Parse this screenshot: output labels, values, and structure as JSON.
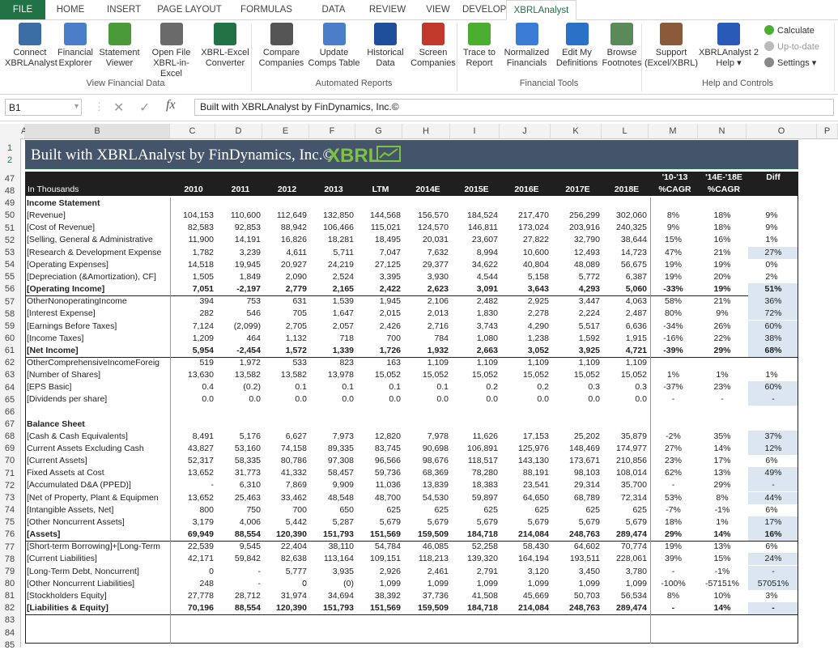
{
  "tabs": [
    "FILE",
    "HOME",
    "INSERT",
    "PAGE LAYOUT",
    "FORMULAS",
    "DATA",
    "REVIEW",
    "VIEW",
    "DEVELOPER",
    "XBRLAnalyst"
  ],
  "ribbon": {
    "buttons": [
      {
        "label": "Connect\nXBRLAnalyst",
        "icon": "connect-icon",
        "color": "#3a6ea5"
      },
      {
        "label": "Financial\nExplorer",
        "icon": "financial-explorer-icon",
        "color": "#4a7ec8"
      },
      {
        "label": "Statement\nViewer",
        "icon": "statement-viewer-icon",
        "color": "#4a9a3a"
      },
      {
        "label": "Open File\nXBRL-in-Excel",
        "icon": "open-file-icon",
        "color": "#6a6a6a"
      },
      {
        "label": "XBRL-Excel\nConverter",
        "icon": "converter-icon",
        "color": "#217346"
      },
      {
        "label": "Compare\nCompanies",
        "icon": "compare-companies-icon",
        "color": "#555"
      },
      {
        "label": "Update\nComps Table",
        "icon": "update-comps-icon",
        "color": "#4a7ec8"
      },
      {
        "label": "Historical\nData",
        "icon": "historical-data-icon",
        "color": "#1f4e9a"
      },
      {
        "label": "Screen\nCompanies",
        "icon": "screen-companies-icon",
        "color": "#c0392b"
      },
      {
        "label": "Trace to\nReport",
        "icon": "trace-report-icon",
        "color": "#4cae30"
      },
      {
        "label": "Normalized\nFinancials",
        "icon": "normalized-financials-icon",
        "color": "#3a7bd5"
      },
      {
        "label": "Edit My\nDefinitions",
        "icon": "edit-definitions-icon",
        "color": "#2a72c8"
      },
      {
        "label": "Browse\nFootnotes",
        "icon": "browse-footnotes-icon",
        "color": "#5a8a5a"
      },
      {
        "label": "Support\n(Excel/XBRL)",
        "icon": "support-icon",
        "color": "#8a5a3a"
      },
      {
        "label": "XBRLAnalyst 2\nHelp ▾",
        "icon": "help-icon",
        "color": "#2a5ab8"
      }
    ],
    "groups": [
      "View Financial Data",
      "Automated Reports",
      "Financial Tools",
      "Help and Controls"
    ],
    "small": {
      "calculate": "Calculate",
      "uptodate": "Up-to-date",
      "settings": "Settings ▾"
    }
  },
  "formula_bar": {
    "cell": "B1",
    "content": "Built with XBRLAnalyst by FinDynamics, Inc.©"
  },
  "columns": [
    "A",
    "B",
    "C",
    "D",
    "E",
    "F",
    "G",
    "H",
    "I",
    "J",
    "K",
    "L",
    "M",
    "N",
    "O",
    "P"
  ],
  "rows": [
    "1",
    "2",
    "47",
    "48",
    "49",
    "50",
    "51",
    "52",
    "53",
    "54",
    "55",
    "56",
    "57",
    "58",
    "59",
    "60",
    "61",
    "62",
    "63",
    "64",
    "65",
    "66",
    "67",
    "68",
    "69",
    "70",
    "71",
    "72",
    "73",
    "74",
    "75",
    "76",
    "77",
    "78",
    "79",
    "80",
    "81",
    "82",
    "83",
    "84",
    "85"
  ],
  "sheet": {
    "title": "Built with XBRLAnalyst by FinDynamics, Inc.©",
    "logo": "XBRL",
    "header_top": {
      "m": "'10-'13",
      "n": "'14E-'18E",
      "o": "Diff"
    },
    "header": [
      "In Thousands",
      "2010",
      "2011",
      "2012",
      "2013",
      "LTM",
      "2014E",
      "2015E",
      "2016E",
      "2017E",
      "2018E",
      "%CAGR",
      "%CAGR",
      ""
    ],
    "data_rows": [
      {
        "label": "Income Statement",
        "bold": true,
        "section": true,
        "vals": []
      },
      {
        "label": "[Revenue]",
        "vals": [
          "104,153",
          "110,600",
          "112,649",
          "132,850",
          "144,568",
          "156,570",
          "184,524",
          "217,470",
          "256,299",
          "302,060",
          "8%",
          "18%",
          "9%"
        ]
      },
      {
        "label": "[Cost of Revenue]",
        "vals": [
          "82,583",
          "92,853",
          "88,942",
          "106,466",
          "115,021",
          "124,570",
          "146,811",
          "173,024",
          "203,916",
          "240,325",
          "9%",
          "18%",
          "9%"
        ]
      },
      {
        "label": "[Selling, General & Administrative",
        "vals": [
          "11,900",
          "14,191",
          "16,826",
          "18,281",
          "18,495",
          "20,031",
          "23,607",
          "27,822",
          "32,790",
          "38,644",
          "15%",
          "16%",
          "1%"
        ]
      },
      {
        "label": "[Research & Development Expense",
        "vals": [
          "1,782",
          "3,239",
          "4,611",
          "5,711",
          "7,047",
          "7,632",
          "8,994",
          "10,600",
          "12,493",
          "14,723",
          "47%",
          "21%",
          "27%"
        ],
        "hl": true
      },
      {
        "label": "[Operating Expenses]",
        "vals": [
          "14,518",
          "19,945",
          "20,927",
          "24,219",
          "27,125",
          "29,377",
          "34,622",
          "40,804",
          "48,089",
          "56,675",
          "19%",
          "19%",
          "0%"
        ]
      },
      {
        "label": "[Depreciation (&Amortization), CF]",
        "vals": [
          "1,505",
          "1,849",
          "2,090",
          "2,524",
          "3,395",
          "3,930",
          "4,544",
          "5,158",
          "5,772",
          "6,387",
          "19%",
          "20%",
          "2%"
        ]
      },
      {
        "label": "[Operating Income]",
        "bold": true,
        "line": true,
        "vals": [
          "7,051",
          "-2,197",
          "2,779",
          "2,165",
          "2,422",
          "2,623",
          "3,091",
          "3,643",
          "4,293",
          "5,060",
          "-33%",
          "19%",
          "51%"
        ],
        "hl": true
      },
      {
        "label": "OtherNonoperatingIncome",
        "vals": [
          "394",
          "753",
          "631",
          "1,539",
          "1,945",
          "2,106",
          "2,482",
          "2,925",
          "3,447",
          "4,063",
          "58%",
          "21%",
          "36%"
        ],
        "hl": true
      },
      {
        "label": "[Interest Expense]",
        "vals": [
          "282",
          "546",
          "705",
          "1,647",
          "2,015",
          "2,013",
          "1,830",
          "2,278",
          "2,224",
          "2,487",
          "80%",
          "9%",
          "72%"
        ],
        "hl": true
      },
      {
        "label": "[Earnings Before Taxes]",
        "vals": [
          "7,124",
          "(2,099)",
          "2,705",
          "2,057",
          "2,426",
          "2,716",
          "3,743",
          "4,290",
          "5,517",
          "6,636",
          "-34%",
          "26%",
          "60%"
        ],
        "hl": true
      },
      {
        "label": "[Income Taxes]",
        "vals": [
          "1,209",
          "464",
          "1,132",
          "718",
          "700",
          "784",
          "1,080",
          "1,238",
          "1,592",
          "1,915",
          "-16%",
          "22%",
          "38%"
        ],
        "hl": true
      },
      {
        "label": "[Net Income]",
        "bold": true,
        "line": true,
        "vals": [
          "5,954",
          "-2,454",
          "1,572",
          "1,339",
          "1,726",
          "1,932",
          "2,663",
          "3,052",
          "3,925",
          "4,721",
          "-39%",
          "29%",
          "68%"
        ],
        "hl": true
      },
      {
        "label": "OtherComprehensiveIncomeForeig",
        "vals": [
          "519",
          "1,972",
          "533",
          "823",
          "163",
          "1,109",
          "1,109",
          "1,109",
          "1,109",
          "1,109",
          "",
          "",
          ""
        ]
      },
      {
        "label": "[Number of Shares]",
        "vals": [
          "13,630",
          "13,582",
          "13,582",
          "13,978",
          "15,052",
          "15,052",
          "15,052",
          "15,052",
          "15,052",
          "15,052",
          "1%",
          "1%",
          "1%"
        ]
      },
      {
        "label": "[EPS Basic]",
        "vals": [
          "0.4",
          "(0.2)",
          "0.1",
          "0.1",
          "0.1",
          "0.1",
          "0.2",
          "0.2",
          "0.3",
          "0.3",
          "-37%",
          "23%",
          "60%"
        ],
        "hl": true
      },
      {
        "label": "[Dividends per share]",
        "vals": [
          "0.0",
          "0.0",
          "0.0",
          "0.0",
          "0.0",
          "0.0",
          "0.0",
          "0.0",
          "0.0",
          "0.0",
          "-",
          "-",
          "-"
        ],
        "hl": true
      },
      {
        "label": "",
        "vals": []
      },
      {
        "label": "Balance Sheet",
        "bold": true,
        "section": true,
        "vals": []
      },
      {
        "label": "[Cash & Cash Equivalents]",
        "vals": [
          "8,491",
          "5,176",
          "6,627",
          "7,973",
          "12,820",
          "7,978",
          "11,626",
          "17,153",
          "25,202",
          "35,879",
          "-2%",
          "35%",
          "37%"
        ],
        "hl": true
      },
      {
        "label": "Current Assets Excluding Cash",
        "vals": [
          "43,827",
          "53,160",
          "74,158",
          "89,335",
          "83,745",
          "90,698",
          "106,891",
          "125,976",
          "148,469",
          "174,977",
          "27%",
          "14%",
          "12%"
        ],
        "hl": true
      },
      {
        "label": "[Current Assets]",
        "vals": [
          "52,317",
          "58,335",
          "80,786",
          "97,308",
          "96,566",
          "98,676",
          "118,517",
          "143,130",
          "173,671",
          "210,856",
          "23%",
          "17%",
          "6%"
        ]
      },
      {
        "label": "Fixed Assets at Cost",
        "vals": [
          "13,652",
          "31,773",
          "41,332",
          "58,457",
          "59,736",
          "68,369",
          "78,280",
          "88,191",
          "98,103",
          "108,014",
          "62%",
          "13%",
          "49%"
        ],
        "hl": true
      },
      {
        "label": "[Accumulated D&A (PPED)]",
        "vals": [
          "-",
          "6,310",
          "7,869",
          "9,909",
          "11,036",
          "13,839",
          "18,383",
          "23,541",
          "29,314",
          "35,700",
          "-",
          "29%",
          "-"
        ],
        "hl": true
      },
      {
        "label": "[Net of Property, Plant & Equipmen",
        "vals": [
          "13,652",
          "25,463",
          "33,462",
          "48,548",
          "48,700",
          "54,530",
          "59,897",
          "64,650",
          "68,789",
          "72,314",
          "53%",
          "8%",
          "44%"
        ],
        "hl": true
      },
      {
        "label": "[Intangible Assets, Net]",
        "vals": [
          "800",
          "750",
          "700",
          "650",
          "625",
          "625",
          "625",
          "625",
          "625",
          "625",
          "-7%",
          "-1%",
          "6%"
        ]
      },
      {
        "label": "[Other Noncurrent Assets]",
        "vals": [
          "3,179",
          "4,006",
          "5,442",
          "5,287",
          "5,679",
          "5,679",
          "5,679",
          "5,679",
          "5,679",
          "5,679",
          "18%",
          "1%",
          "17%"
        ],
        "hl": true
      },
      {
        "label": "[Assets]",
        "bold": true,
        "line": true,
        "vals": [
          "69,949",
          "88,554",
          "120,390",
          "151,793",
          "151,569",
          "159,509",
          "184,718",
          "214,084",
          "248,763",
          "289,474",
          "29%",
          "14%",
          "16%"
        ],
        "hl": true
      },
      {
        "label": "[Short-term Borrowing]+[Long-Term",
        "vals": [
          "22,539",
          "9,545",
          "22,404",
          "38,110",
          "54,784",
          "46,085",
          "52,258",
          "58,430",
          "64,602",
          "70,774",
          "19%",
          "13%",
          "6%"
        ]
      },
      {
        "label": "[Current Liabilities]",
        "vals": [
          "42,171",
          "59,842",
          "82,638",
          "113,164",
          "109,151",
          "118,213",
          "139,320",
          "164,194",
          "193,511",
          "228,061",
          "39%",
          "15%",
          "24%"
        ],
        "hl": true
      },
      {
        "label": "[Long-Term Debt, Noncurrent]",
        "vals": [
          "0",
          "-",
          "5,777",
          "3,935",
          "2,926",
          "2,461",
          "2,791",
          "3,120",
          "3,450",
          "3,780",
          "-",
          "-1%",
          "-"
        ],
        "hl": true
      },
      {
        "label": "[Other Noncurrent Liabilities]",
        "vals": [
          "248",
          "-",
          "0",
          "(0)",
          "1,099",
          "1,099",
          "1,099",
          "1,099",
          "1,099",
          "1,099",
          "-100%",
          "-57151%",
          "57051%"
        ],
        "hl": true
      },
      {
        "label": "[Stockholders Equity]",
        "vals": [
          "27,778",
          "28,712",
          "31,974",
          "34,694",
          "38,392",
          "37,736",
          "41,508",
          "45,669",
          "50,703",
          "56,534",
          "8%",
          "10%",
          "3%"
        ]
      },
      {
        "label": "[Liabilities & Equity]",
        "bold": true,
        "line": true,
        "vals": [
          "70,196",
          "88,554",
          "120,390",
          "151,793",
          "151,569",
          "159,509",
          "184,718",
          "214,084",
          "248,763",
          "289,474",
          "-",
          "14%",
          "-"
        ],
        "hl": true
      }
    ]
  }
}
